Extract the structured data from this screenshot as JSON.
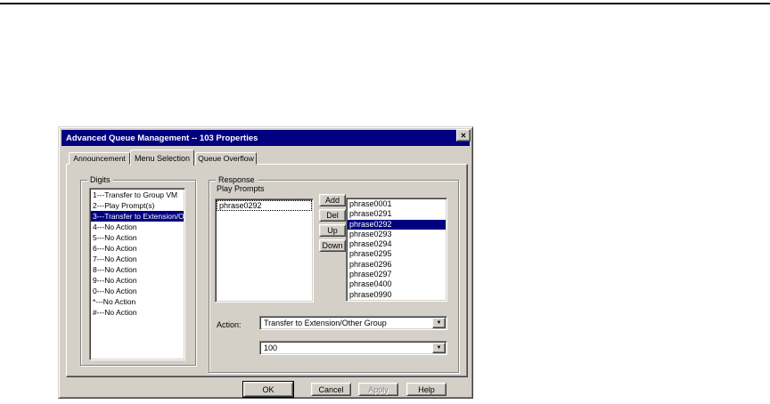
{
  "window": {
    "title": "Advanced Queue Management -- 103 Properties",
    "close_icon": "✕"
  },
  "tabs": [
    {
      "label": "Announcement",
      "active": false
    },
    {
      "label": "Menu Selection",
      "active": true
    },
    {
      "label": "Queue Overflow",
      "active": false
    }
  ],
  "digits": {
    "group_label": "Digits",
    "items": [
      {
        "label": "1---Transfer to Group VM",
        "selected": false
      },
      {
        "label": "2---Play Prompt(s)",
        "selected": false
      },
      {
        "label": "3---Transfer to Extension/O",
        "selected": true
      },
      {
        "label": "4---No Action",
        "selected": false
      },
      {
        "label": "5---No Action",
        "selected": false
      },
      {
        "label": "6---No Action",
        "selected": false
      },
      {
        "label": "7---No Action",
        "selected": false
      },
      {
        "label": "8---No Action",
        "selected": false
      },
      {
        "label": "9---No Action",
        "selected": false
      },
      {
        "label": "0---No Action",
        "selected": false
      },
      {
        "label": "*---No Action",
        "selected": false
      },
      {
        "label": "#---No Action",
        "selected": false
      }
    ]
  },
  "response": {
    "group_label": "Response",
    "play_prompts_label": "Play Prompts",
    "selected_prompts": [
      {
        "label": "phrase0292",
        "focused": true
      }
    ],
    "add_label": "Add",
    "del_label": "Del",
    "up_label": "Up",
    "down_label": "Down",
    "available_prompts": [
      {
        "label": "phrase0001",
        "selected": false
      },
      {
        "label": "phrase0291",
        "selected": false
      },
      {
        "label": "phrase0292",
        "selected": true
      },
      {
        "label": "phrase0293",
        "selected": false
      },
      {
        "label": "phrase0294",
        "selected": false
      },
      {
        "label": "phrase0295",
        "selected": false
      },
      {
        "label": "phrase0296",
        "selected": false
      },
      {
        "label": "phrase0297",
        "selected": false
      },
      {
        "label": "phrase0400",
        "selected": false
      },
      {
        "label": "phrase0990",
        "selected": false
      }
    ],
    "action_label": "Action:",
    "action_value": "Transfer to Extension/Other Group",
    "extension_value": "100",
    "dropdown_icon": "▼"
  },
  "footer": {
    "ok_label": "OK",
    "cancel_label": "Cancel",
    "apply_label": "Apply",
    "apply_disabled": true,
    "help_label": "Help"
  },
  "colors": {
    "titlebar": "#000080",
    "titlebar_text": "#ffffff",
    "selection": "#000080",
    "selection_text": "#ffffff",
    "dialog_face": "#d4d0c8"
  }
}
